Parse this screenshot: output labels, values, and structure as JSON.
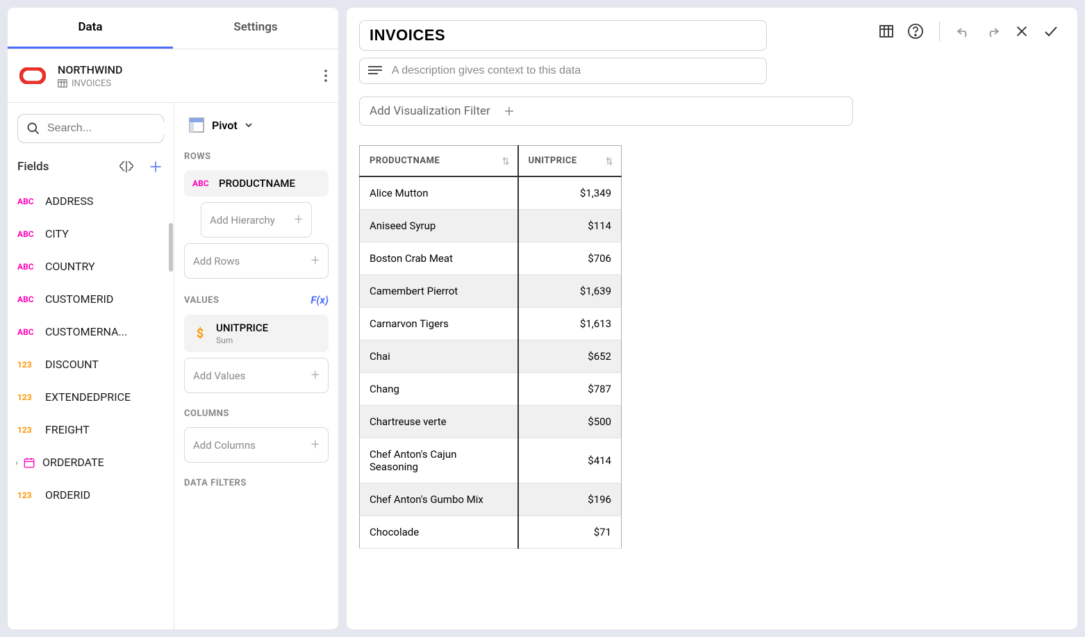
{
  "sidebar": {
    "tabs": {
      "data": "Data",
      "settings": "Settings"
    },
    "datasource": {
      "name": "NORTHWIND",
      "table": "INVOICES"
    },
    "search_placeholder": "Search...",
    "fields_label": "Fields",
    "fields": [
      {
        "type": "abc",
        "name": "ADDRESS"
      },
      {
        "type": "abc",
        "name": "CITY"
      },
      {
        "type": "abc",
        "name": "COUNTRY"
      },
      {
        "type": "abc",
        "name": "CUSTOMERID"
      },
      {
        "type": "abc",
        "name": "CUSTOMERNA..."
      },
      {
        "type": "123",
        "name": "DISCOUNT"
      },
      {
        "type": "123",
        "name": "EXTENDEDPRICE"
      },
      {
        "type": "123",
        "name": "FREIGHT"
      },
      {
        "type": "date",
        "name": "ORDERDATE",
        "expandable": true
      },
      {
        "type": "123",
        "name": "ORDERID"
      }
    ]
  },
  "config": {
    "viz_type": "Pivot",
    "sections": {
      "rows_label": "ROWS",
      "values_label": "VALUES",
      "columns_label": "COLUMNS",
      "filters_label": "DATA FILTERS"
    },
    "rows_chip": "PRODUCTNAME",
    "add_hierarchy": "Add Hierarchy",
    "add_rows": "Add Rows",
    "values_chip": {
      "name": "UNITPRICE",
      "agg": "Sum"
    },
    "add_values": "Add Values",
    "add_columns": "Add Columns",
    "fx": "F(x)"
  },
  "main": {
    "title": "INVOICES",
    "desc_placeholder": "A description gives context to this data",
    "filter_btn": "Add Visualization Filter",
    "table": {
      "col1": "PRODUCTNAME",
      "col2": "UNITPRICE",
      "rows": [
        {
          "n": "Alice Mutton",
          "v": "$1,349"
        },
        {
          "n": "Aniseed Syrup",
          "v": "$114"
        },
        {
          "n": "Boston Crab Meat",
          "v": "$706"
        },
        {
          "n": "Camembert Pierrot",
          "v": "$1,639"
        },
        {
          "n": "Carnarvon Tigers",
          "v": "$1,613"
        },
        {
          "n": "Chai",
          "v": "$652"
        },
        {
          "n": "Chang",
          "v": "$787"
        },
        {
          "n": "Chartreuse verte",
          "v": "$500"
        },
        {
          "n": "Chef Anton's Cajun Seasoning",
          "v": "$414"
        },
        {
          "n": "Chef Anton's Gumbo Mix",
          "v": "$196"
        },
        {
          "n": "Chocolade",
          "v": "$71"
        }
      ]
    }
  }
}
